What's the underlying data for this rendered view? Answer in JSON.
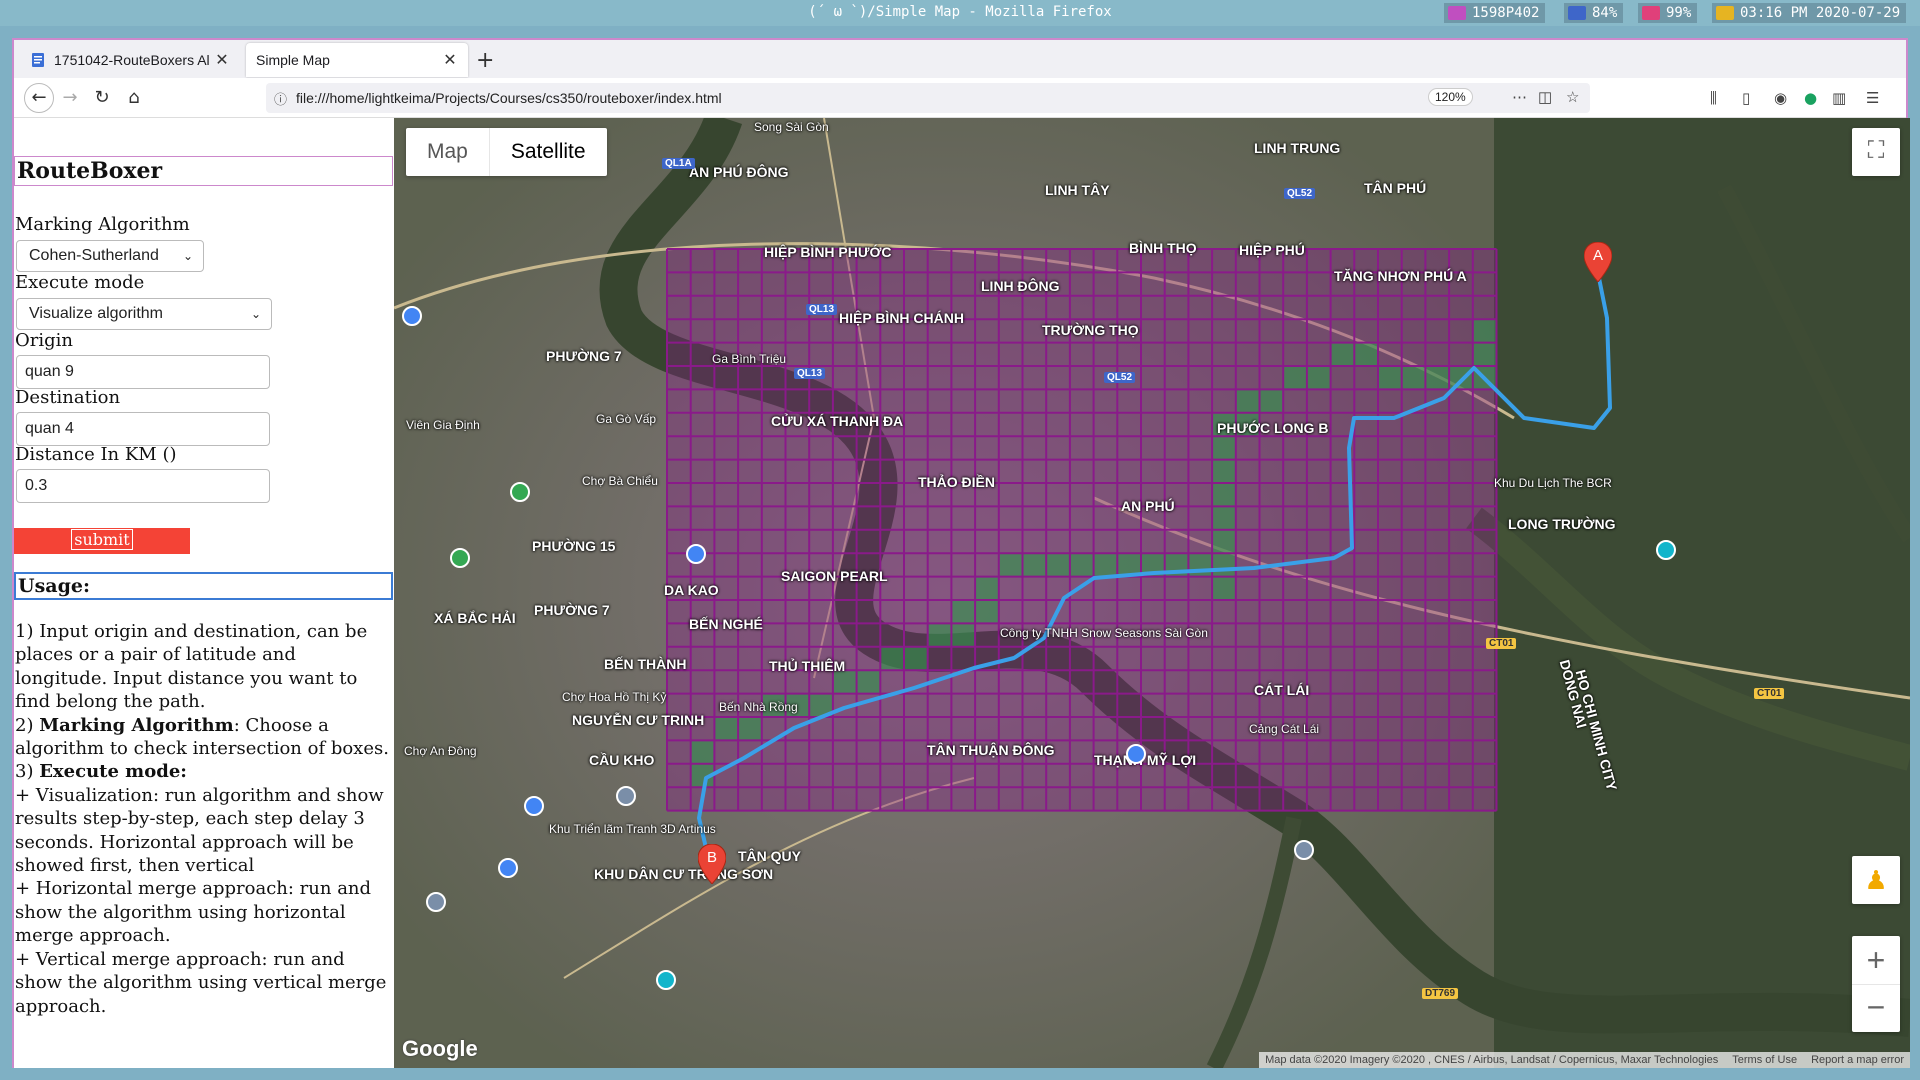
{
  "system_bar": {
    "title": "(´  ω  `)/Simple Map - Mozilla Firefox",
    "stats": [
      {
        "icon": "signal-icon",
        "value": "1598P402",
        "color": "#c04fc0"
      },
      {
        "icon": "speaker-icon",
        "value": "84%",
        "color": "#3e66c9"
      },
      {
        "icon": "battery-icon",
        "value": "99%",
        "color": "#e0407a"
      },
      {
        "icon": "clock-icon",
        "value": "03:16 PM 2020-07-29",
        "color": "#e6b422"
      }
    ]
  },
  "tabs": [
    {
      "label": "1751042-RouteBoxers Al",
      "active": false
    },
    {
      "label": "Simple Map",
      "active": true
    }
  ],
  "navbar": {
    "url": "file:///home/lightkeima/Projects/Courses/cs350/routeboxer/index.html",
    "zoom": "120%"
  },
  "sidebar": {
    "title": "RouteBoxer",
    "marking_label": "Marking Algorithm",
    "marking_value": "Cohen-Sutherland",
    "execute_label": "Execute mode",
    "execute_value": "Visualize algorithm",
    "origin_label": "Origin",
    "origin_value": "quan 9",
    "destination_label": "Destination",
    "destination_value": "quan 4",
    "distance_label": "Distance In KM ()",
    "distance_value": "0.3",
    "submit_label": "submit",
    "usage_title": "Usage:",
    "usage": {
      "p1": "1) Input origin and destination, can be places or a pair of latitude and longitude. Input distance you want to find belong the path.",
      "p2_prefix": "2) ",
      "p2_bold": "Marking Algorithm",
      "p2_rest": ": Choose a algorithm to check intersection of boxes.",
      "p3_prefix": "3) ",
      "p3_bold": "Execute mode:",
      "p3_a": "+ Visualization: run algorithm and show results step-by-step, each step delay 3 seconds. Horizontal approach will be showed first, then vertical",
      "p3_b": "+ Horizontal merge approach: run and show the algorithm using horizontal merge approach.",
      "p3_c": "+ Vertical merge approach: run and show the algorithm using vertical merge approach."
    }
  },
  "map": {
    "type_map": "Map",
    "type_satellite": "Satellite",
    "active_type": "Satellite",
    "marker_a": "A",
    "marker_b": "B",
    "logo": "Google",
    "attribution": "Map data ©2020 Imagery ©2020 , CNES / Airbus, Landsat / Copernicus, Maxar Technologies",
    "terms": "Terms of Use",
    "report": "Report a map error",
    "grid_color": "#8a1a8a",
    "route_color": "#3aa0e8",
    "box_highlight_color": "#2e9a4a",
    "places": [
      "Song Sài Gòn",
      "AN PHÚ ĐÔNG",
      "LINH TRUNG",
      "LINH TÂY",
      "TÂN PHÚ",
      "HIỆP PHÚ",
      "HIỆP BÌNH PHƯỚC",
      "BÌNH THỌ",
      "LINH ĐÔNG",
      "TĂNG NHƠN PHÚ A",
      "HIỆP BÌNH CHÁNH",
      "TRƯỜNG THỌ",
      "PHƯỜNG 7",
      "Ga Bình Triệu",
      "CỬU XÁ THANH ĐA",
      "Ga Gò Vấp",
      "PHƯỚC LONG B",
      "THẢO ĐIỀN",
      "AN PHÚ",
      "Khu Du Lịch The BCR",
      "LONG TRƯỜNG",
      "Chợ Bà Chiểu",
      "PHƯỜNG 15",
      "SAIGON PEARL",
      "DA KAO",
      "PHƯỜNG 7",
      "XÁ BẮC HẢI",
      "BẾN NGHÉ",
      "Công ty TNHH Snow Seasons Sài Gòn",
      "BẾN THÀNH",
      "THỦ THIÊM",
      "CÁT LÁI",
      "Chợ Hoa Hồ Thị Kỷ",
      "Bến Nhà Rồng",
      "NGUYỄN CƯ TRINH",
      "Cảng Cát Lái",
      "Chợ An Đông",
      "CẦU KHO",
      "TÂN THUẬN ĐÔNG",
      "THẠNH MỸ LỢI",
      "Khu Triển lãm Tranh 3D Artinus",
      "TÂN QUY",
      "KHU DÂN CƯ TRUNG SƠN",
      "HO CHI MINH CITY",
      "DONG NAI",
      "Viên Gia Định"
    ],
    "roads": [
      "QL1A",
      "QL52",
      "QL13",
      "QL13",
      "QL52",
      "CT01",
      "CT01",
      "DT769"
    ]
  }
}
